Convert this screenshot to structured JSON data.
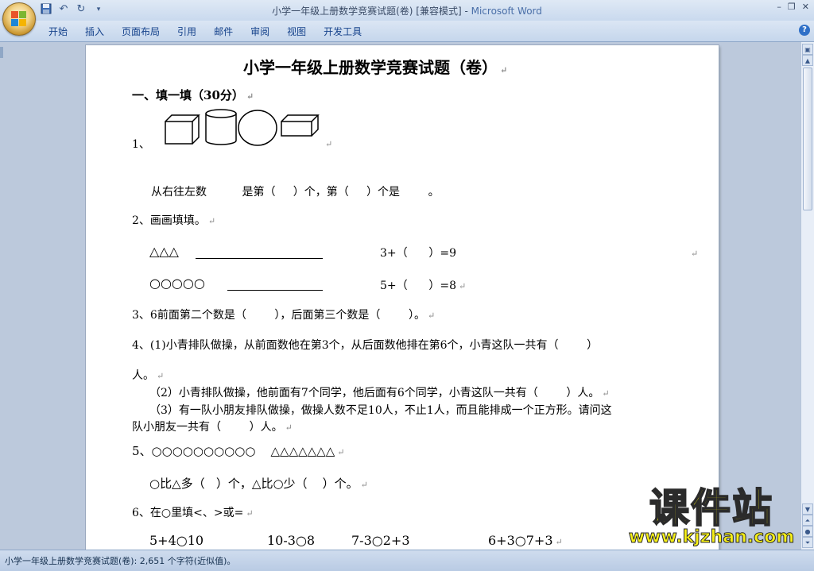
{
  "window": {
    "title": "小学一年级上册数学竞赛试题(卷) [兼容模式] - ",
    "app_name": "Microsoft Word",
    "controls": [
      "–",
      "❐",
      "✕"
    ]
  },
  "quick_access": {
    "save_icon": "save-icon",
    "undo_icon": "undo-icon",
    "redo_icon": "redo-icon"
  },
  "ribbon": {
    "tabs": [
      "开始",
      "插入",
      "页面布局",
      "引用",
      "邮件",
      "审阅",
      "视图",
      "开发工具"
    ]
  },
  "document": {
    "title": "小学一年级上册数学竞赛试题（卷）",
    "section1": "一、填一填（30分）",
    "q1_num": "1、",
    "q1_line": "从右往左数          是第（     ）个，第（     ）个是        。",
    "q2": "2、画画填填。",
    "q2_a_left": "△△△",
    "q2_a_right": "3+（      ）=9",
    "q2_b_left": "○○○○○",
    "q2_b_right": "5+（      ）=8",
    "q3": "3、6前面第二个数是（        ），后面第三个数是（        ）。",
    "q4_line1": "4、(1)小青排队做操，从前面数他在第3个，从后面数他排在第6个，小青这队一共有（        ）",
    "q4_line2": "人。",
    "q4_2": "（2）小青排队做操，他前面有7个同学，他后面有6个同学，小青这队一共有（        ）人。",
    "q4_3a": "（3）有一队小朋友排队做操，做操人数不足10人，不止1人，而且能排成一个正方形。请问这",
    "q4_3b": "队小朋友一共有（        ）人。",
    "q5": "5、○○○○○○○○○○    △△△△△△△",
    "q5_line": "○比△多（   ）个，△比○少（    ）个。",
    "q6": "6、在○里填<、>或=",
    "q6_items": [
      "5+4○10",
      "10-3○8",
      "7-3○2+3",
      "6+3○7+3"
    ]
  },
  "status": {
    "text": "小学一年级上册数学竞赛试题(卷): 2,651 个字符(近似值)。"
  },
  "watermark": {
    "big": "课件站",
    "small": "www.kjzhan.com"
  }
}
